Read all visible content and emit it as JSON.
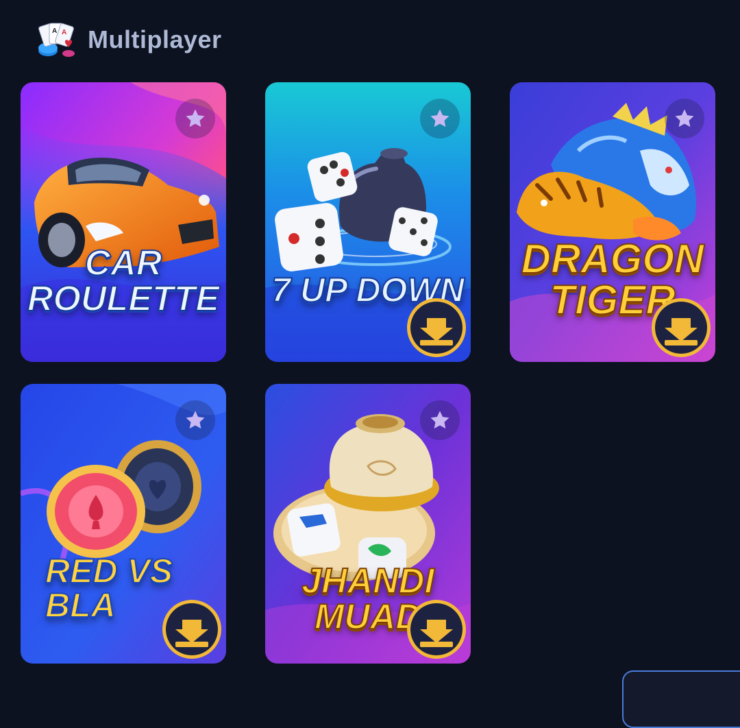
{
  "section": {
    "title": "Multiplayer",
    "icon": "playing-cards-icon"
  },
  "games": [
    {
      "id": "car-roulette",
      "title": "CAR\nROULETTE",
      "favorite_icon": "star-icon",
      "downloadable": false
    },
    {
      "id": "7-up-down",
      "title": "7 UP DOWN",
      "favorite_icon": "star-icon",
      "downloadable": true
    },
    {
      "id": "dragon-tiger",
      "title": "DRAGON\nTIGER",
      "favorite_icon": "star-icon",
      "downloadable": true
    },
    {
      "id": "red-vs-black",
      "title": "RED VS\nBLA",
      "favorite_icon": "star-icon",
      "downloadable": true
    },
    {
      "id": "jhandi-munda",
      "title": "JHANDI\nMUAD",
      "favorite_icon": "star-icon",
      "downloadable": true
    }
  ],
  "colors": {
    "background": "#0d1220",
    "star": "#c9b8f2",
    "download_gold": "#f2b938",
    "download_dark": "#1c2240"
  }
}
